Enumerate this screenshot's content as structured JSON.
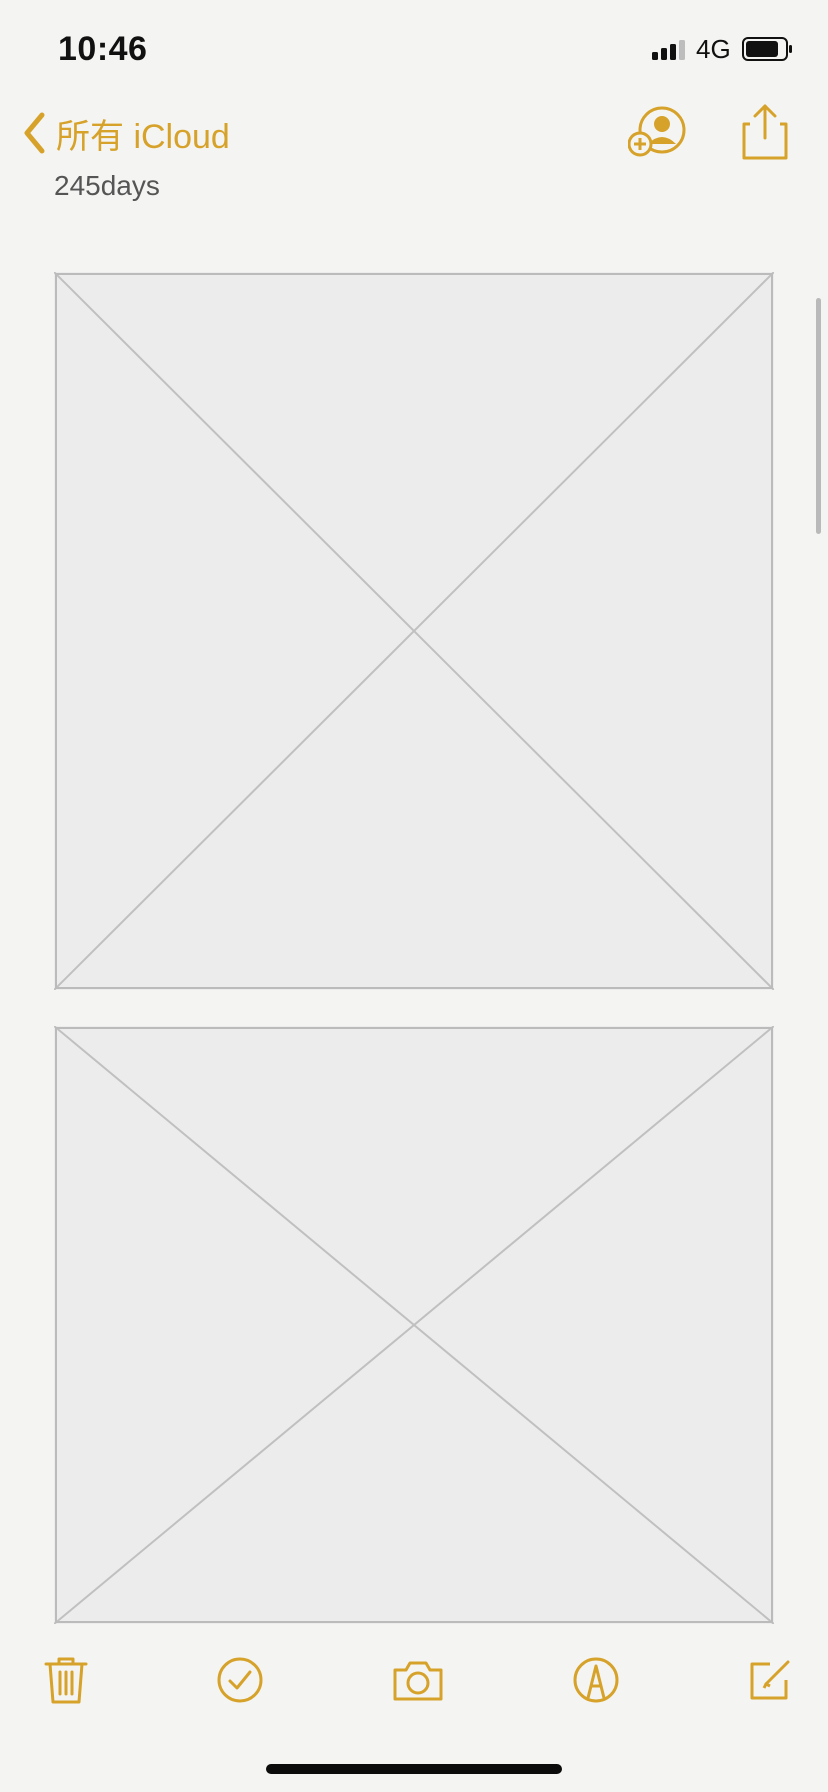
{
  "status_bar": {
    "time": "10:46",
    "network": "4G",
    "icons": [
      "signal-icon",
      "battery-icon"
    ]
  },
  "nav": {
    "back_label": "所有 iCloud",
    "icons": [
      "chevron-left-icon",
      "add-person-icon",
      "share-icon"
    ]
  },
  "note": {
    "subtitle": "245days",
    "photos": [
      {
        "name": "photo-1"
      },
      {
        "name": "photo-2"
      }
    ]
  },
  "toolbar": {
    "icons": [
      "trash-icon",
      "checklist-icon",
      "camera-icon",
      "markup-icon",
      "compose-icon"
    ]
  },
  "theme": {
    "accent": "#d6a22a",
    "background": "#f4f4f2"
  }
}
